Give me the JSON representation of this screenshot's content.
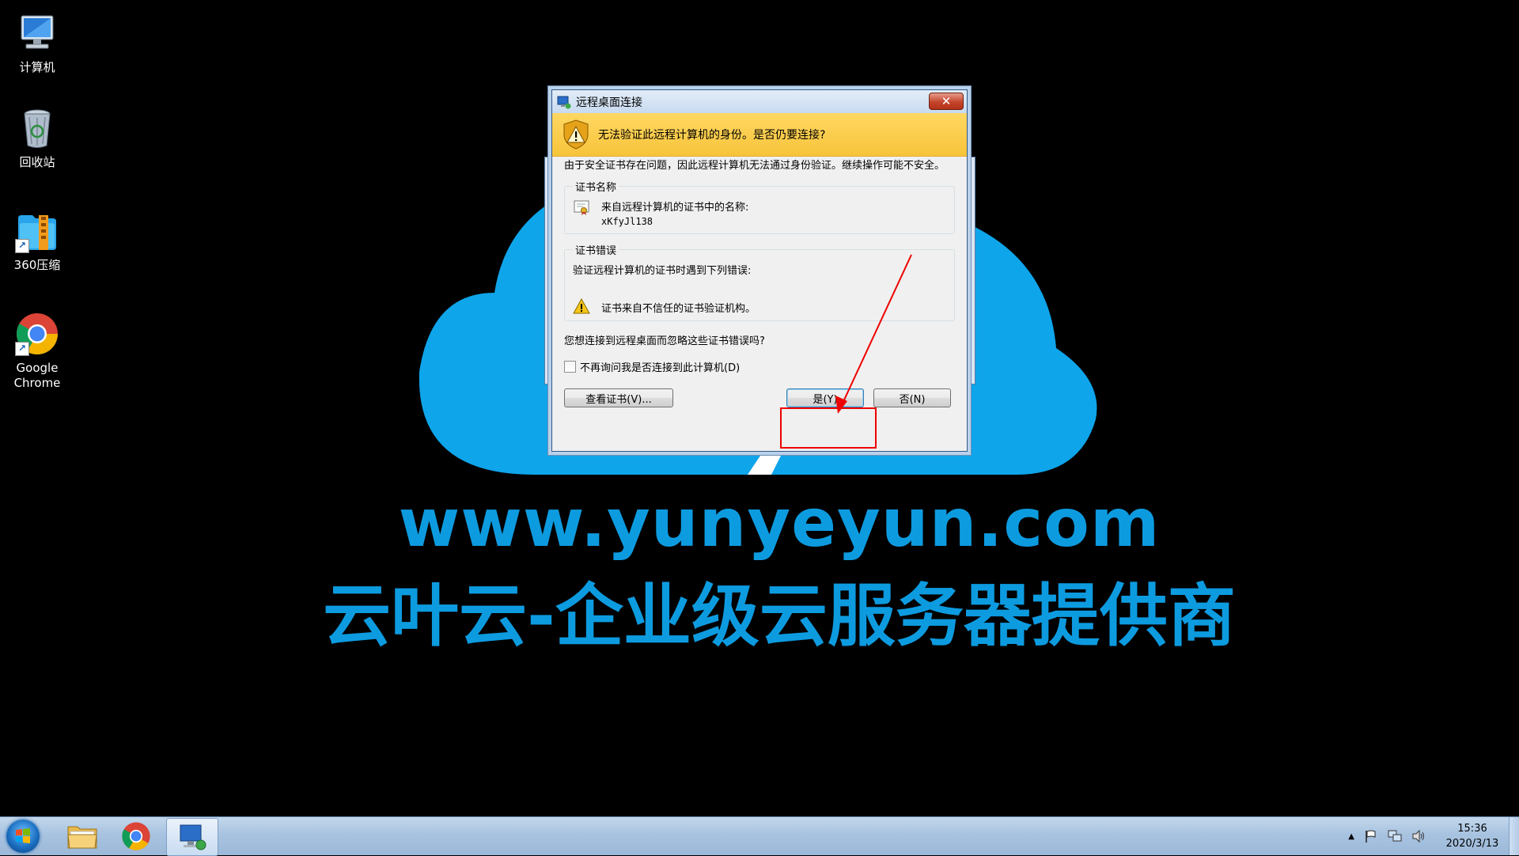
{
  "desktop": {
    "icons": [
      {
        "label": "计算机"
      },
      {
        "label": "回收站"
      },
      {
        "label": "360压缩"
      },
      {
        "label_line1": "Google",
        "label_line2": "Chrome"
      }
    ]
  },
  "wallpaper": {
    "url": "www.yunyeyun.com",
    "slogan": "云叶云-企业级云服务器提供商",
    "accent": "#0d9be0"
  },
  "dialog": {
    "title": "远程桌面连接",
    "close_label": "✕",
    "warning": "无法验证此远程计算机的身份。是否仍要连接?",
    "intro": "由于安全证书存在问题，因此远程计算机无法通过身份验证。继续操作可能不安全。",
    "cert_name": {
      "legend": "证书名称",
      "label": "来自远程计算机的证书中的名称:",
      "value": "xKfyJl138"
    },
    "cert_error": {
      "legend": "证书错误",
      "label": "验证远程计算机的证书时遇到下列错误:",
      "item": "证书来自不信任的证书验证机构。"
    },
    "question": "您想连接到远程桌面而忽略这些证书错误吗?",
    "checkbox_label": "不再询问我是否连接到此计算机(D)",
    "buttons": {
      "view_cert": "查看证书(V)...",
      "yes": "是(Y)",
      "no": "否(N)"
    }
  },
  "taskbar": {
    "clock_time": "15:36",
    "clock_date": "2020/3/13",
    "tray_expand": "▲"
  }
}
